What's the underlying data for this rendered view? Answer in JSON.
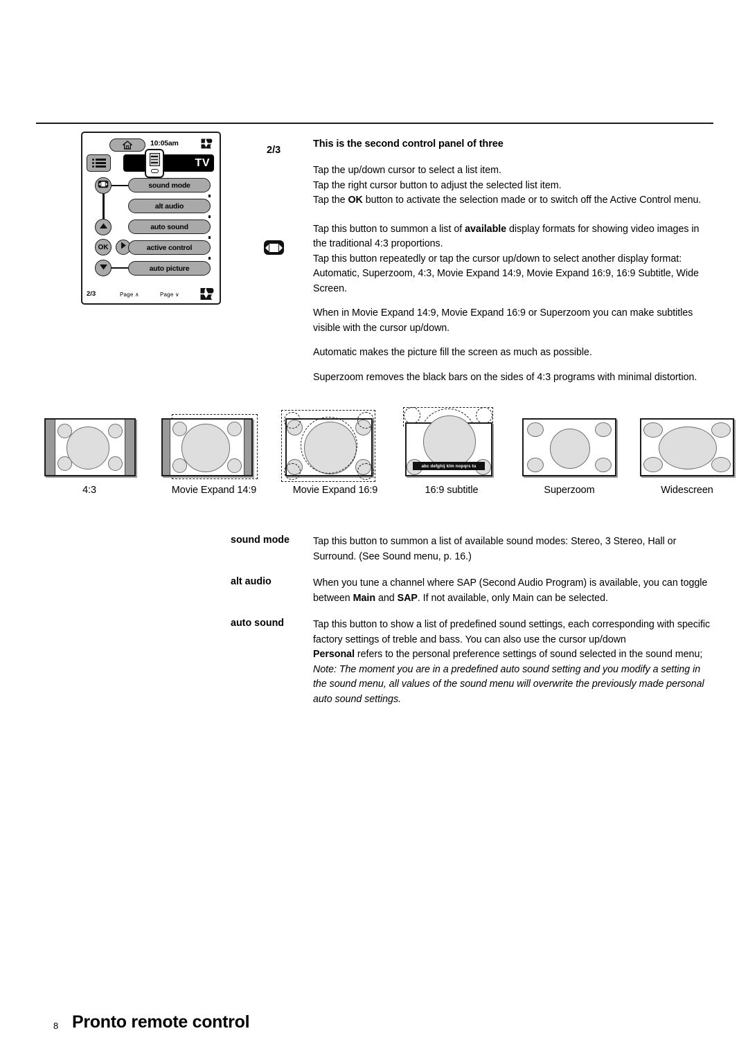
{
  "remote": {
    "home_icon": "home-icon",
    "clock": "10:05am",
    "battery_icon": "battery-icon",
    "list_icon": "list-icon",
    "device_icon": "remote-device-icon",
    "device_label": "TV",
    "format_icon": "display-format-icon",
    "up_icon": "cursor-up-icon",
    "ok_label": "OK",
    "right_icon": "cursor-right-icon",
    "down_icon": "cursor-down-icon",
    "buttons": [
      {
        "label": "sound mode"
      },
      {
        "label": "alt audio"
      },
      {
        "label": "auto sound"
      },
      {
        "label": "active control"
      },
      {
        "label": "auto picture"
      }
    ],
    "page_indicator": "2/3",
    "page_up": "Page ∧",
    "page_down": "Page ∨",
    "scroll_icon": "scroll-updown-icon"
  },
  "section": {
    "number": "2/3",
    "heading": "This is the second control panel of three",
    "intro_lines": [
      "Tap the up/down cursor to select a list item.",
      "Tap the right cursor button to adjust the selected list item."
    ],
    "ok_line_pre": "Tap the ",
    "ok_line_bold": "OK",
    "ok_line_post": " button to activate the selection made or to switch off the Active Control menu.",
    "format_icon_name": "display-format-icon",
    "format_para1_pre": "Tap this button to summon a list of ",
    "format_para1_bold": "available",
    "format_para1_post": " display formats for showing video images in the traditional 4:3 proportions.",
    "format_para2": "Tap this button repeatedly or tap the cursor up/down to select another display format:  Automatic, Superzoom, 4:3, Movie Expand 14:9, Movie Expand 16:9, 16:9 Subtitle, Wide Screen.",
    "format_para3": "When in Movie Expand 14:9, Movie Expand 16:9 or Superzoom you can make subtitles visible with the cursor up/down.",
    "format_para4": "Automatic makes the picture fill the screen as much as possible.",
    "format_para5": "Superzoom removes the black bars on the sides of 4:3 programs with minimal distortion."
  },
  "diagrams": {
    "subtitle_text": "abc defghij klm nopqrs tu",
    "items": [
      {
        "caption": "4:3"
      },
      {
        "caption": "Movie Expand 14:9"
      },
      {
        "caption": "Movie Expand 16:9"
      },
      {
        "caption": "16:9 subtitle"
      },
      {
        "caption": "Superzoom"
      },
      {
        "caption": "Widescreen"
      }
    ]
  },
  "definitions": [
    {
      "term": "sound mode",
      "body": "Tap this button to summon a list of available sound modes: Stereo, 3 Stereo, Hall or Surround. (See Sound menu, p. 16.)"
    },
    {
      "term": "alt audio",
      "body_1": "When you tune a channel where SAP (Second Audio Program) is available, you can toggle between ",
      "bold_1": "Main",
      "body_2": " and ",
      "bold_2": "SAP",
      "body_3": ". If not available, only Main can be selected."
    },
    {
      "term": "auto sound",
      "body_1": "Tap this button to show a list of predefined sound settings, each corresponding with specific factory settings of treble and bass. You can also use the cursor up/down",
      "bold_1": "Personal",
      "body_2": " refers to the personal preference settings of sound selected in the sound menu;",
      "note": "Note: The moment you are in a predefined auto sound setting and you modify a setting in the sound menu, all values of the sound menu will overwrite the previously made personal auto sound settings."
    }
  ],
  "footer": {
    "page_number": "8",
    "title": "Pronto remote control"
  },
  "colors": {
    "rule": "#1a1a1a",
    "button_fill": "#a9a9a9",
    "sidebar_gray": "#9a9a9a",
    "blob_gray": "#dedede"
  }
}
